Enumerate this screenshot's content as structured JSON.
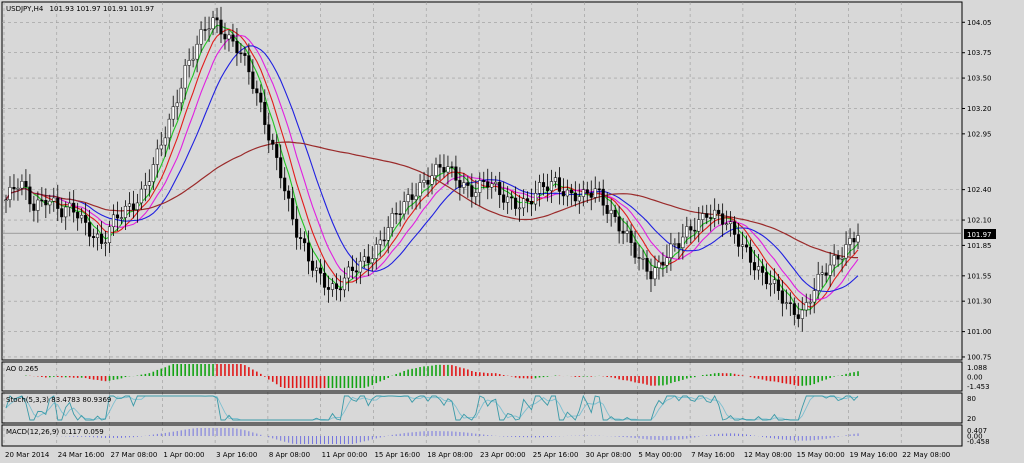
{
  "chart_data": {
    "type": "line",
    "title": "USDJPY,H4",
    "ohlc": "101.93 101.97 101.91 101.97",
    "current_price": "101.97",
    "y_ticks": [
      "104.05",
      "103.75",
      "103.50",
      "103.20",
      "102.95",
      "102.40",
      "102.10",
      "101.85",
      "101.55",
      "101.30",
      "101.00",
      "100.75"
    ],
    "ylim": [
      100.72,
      104.25
    ],
    "x_ticks": [
      "20 Mar 2014",
      "24 Mar 16:00",
      "27 Mar 08:00",
      "1 Apr 00:00",
      "3 Apr 16:00",
      "8 Apr 08:00",
      "11 Apr 00:00",
      "15 Apr 16:00",
      "18 Apr 08:00",
      "23 Apr 00:00",
      "25 Apr 16:00",
      "30 Apr 08:00",
      "5 May 00:00",
      "7 May 16:00",
      "12 May 08:00",
      "15 May 00:00",
      "19 May 16:00",
      "22 May 08:00"
    ],
    "price_path": [
      102.3,
      102.45,
      102.25,
      102.35,
      102.15,
      102.2,
      102.05,
      101.85,
      102.1,
      102.25,
      102.4,
      102.7,
      103.1,
      103.6,
      103.85,
      104.05,
      103.95,
      103.8,
      103.4,
      103.0,
      102.6,
      102.0,
      101.7,
      101.55,
      101.4,
      101.55,
      101.7,
      101.85,
      102.05,
      102.25,
      102.45,
      102.55,
      102.6,
      102.5,
      102.4,
      102.45,
      102.35,
      102.3,
      102.25,
      102.4,
      102.5,
      102.35,
      102.3,
      102.4,
      102.2,
      101.95,
      101.7,
      101.6,
      101.75,
      101.85,
      102.05,
      102.2,
      102.1,
      101.95,
      101.8,
      101.55,
      101.4,
      101.25,
      101.2,
      101.45,
      101.65,
      101.85,
      101.97
    ],
    "indicators": {
      "ao_label": "AO 0.265",
      "ao_scale": [
        "1.088",
        "0.00",
        "-1.453"
      ],
      "stoch_label": "Stoch(5,3,3) 83.4783 80.9369",
      "stoch_scale": [
        "80",
        "20"
      ],
      "macd_label": "MACD(12,26,9) 0.117 0.059",
      "macd_scale": [
        "0.407",
        "0.00",
        "-0.458"
      ]
    },
    "colors": {
      "background": "#d8d8d8",
      "grid": "#9a9a9a",
      "candle": "#000000",
      "ma_lime": "#22c322",
      "ma_red": "#e21c1c",
      "ma_magenta": "#e020e0",
      "ma_blue": "#2020e0",
      "ma_brown": "#9a2a2a",
      "ao_up": "#13a313",
      "ao_down": "#e01818",
      "stoch_main": "#3b9aa8",
      "stoch_signal": "#7fbfd0",
      "macd_hist": "#6a6ae0"
    }
  }
}
